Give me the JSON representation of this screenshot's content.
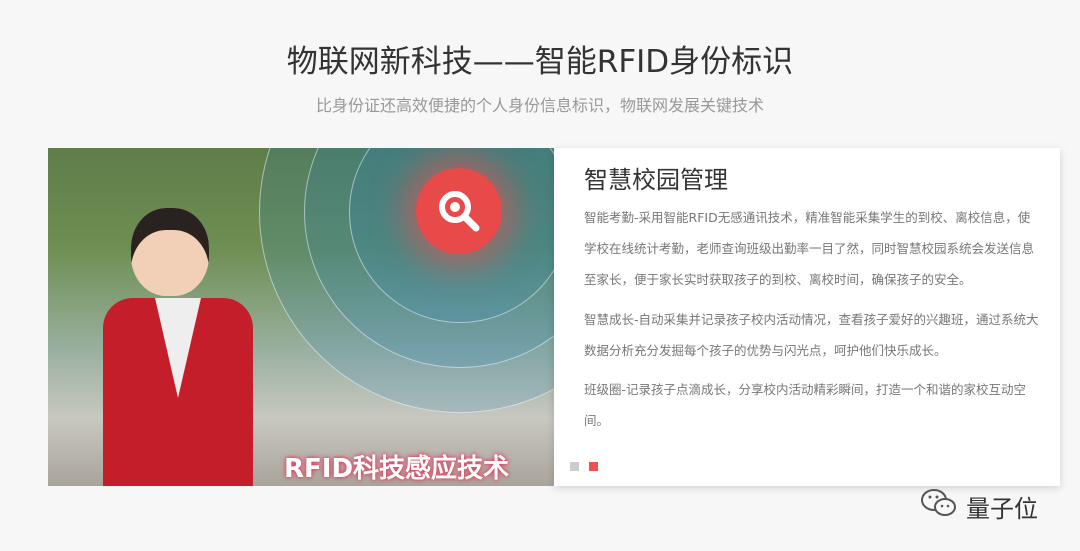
{
  "header": {
    "title": "物联网新科技——智能RFID身份标识",
    "subtitle": "比身份证还高效便捷的个人身份信息标识，物联网发展关键技术"
  },
  "photo": {
    "banner_text": "RFID科技感应技术",
    "badge_icon": "search-icon"
  },
  "card": {
    "title": "智慧校园管理",
    "paragraphs": [
      "智能考勤-采用智能RFID无感通讯技术，精准智能采集学生的到校、离校信息，使学校在线统计考勤，老师查询班级出勤率一目了然，同时智慧校园系统会发送信息至家长，便于家长实时获取孩子的到校、离校时间，确保孩子的安全。",
      "智慧成长-自动采集并记录孩子校内活动情况，查看孩子爱好的兴趣班，通过系统大数据分析充分发掘每个孩子的优势与闪光点，呵护他们快乐成长。",
      "班级圈-记录孩子点滴成长，分享校内活动精彩瞬间，打造一个和谐的家校互动空间。"
    ],
    "carousel": {
      "total": 2,
      "active": 2
    }
  },
  "watermark": {
    "text": "量子位"
  },
  "colors": {
    "accent": "#f05050"
  }
}
